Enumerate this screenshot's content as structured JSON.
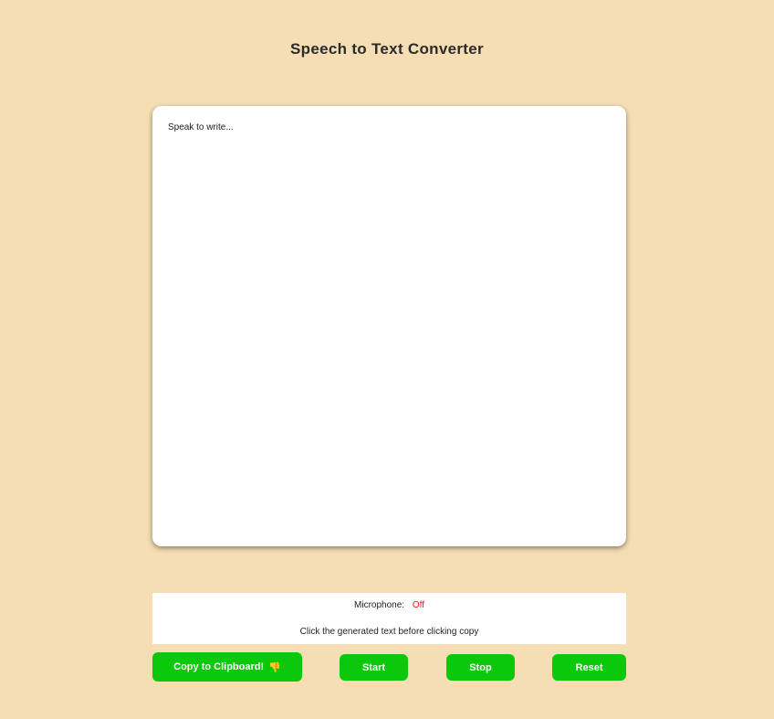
{
  "page": {
    "title": "Speech to Text Converter"
  },
  "editor": {
    "placeholder": "Speak to write..."
  },
  "status": {
    "microphone_label": "Microphone:",
    "microphone_state": "Off",
    "hint": "Click the generated text before clicking copy"
  },
  "buttons": {
    "copy_label": "Copy to Clipboard!",
    "copy_icon": "thumbs-down-icon",
    "start_label": "Start",
    "stop_label": "Stop",
    "reset_label": "Reset"
  },
  "colors": {
    "background": "#f5deb3",
    "button": "#0bc80b",
    "mic_off": "#e01b1b"
  }
}
